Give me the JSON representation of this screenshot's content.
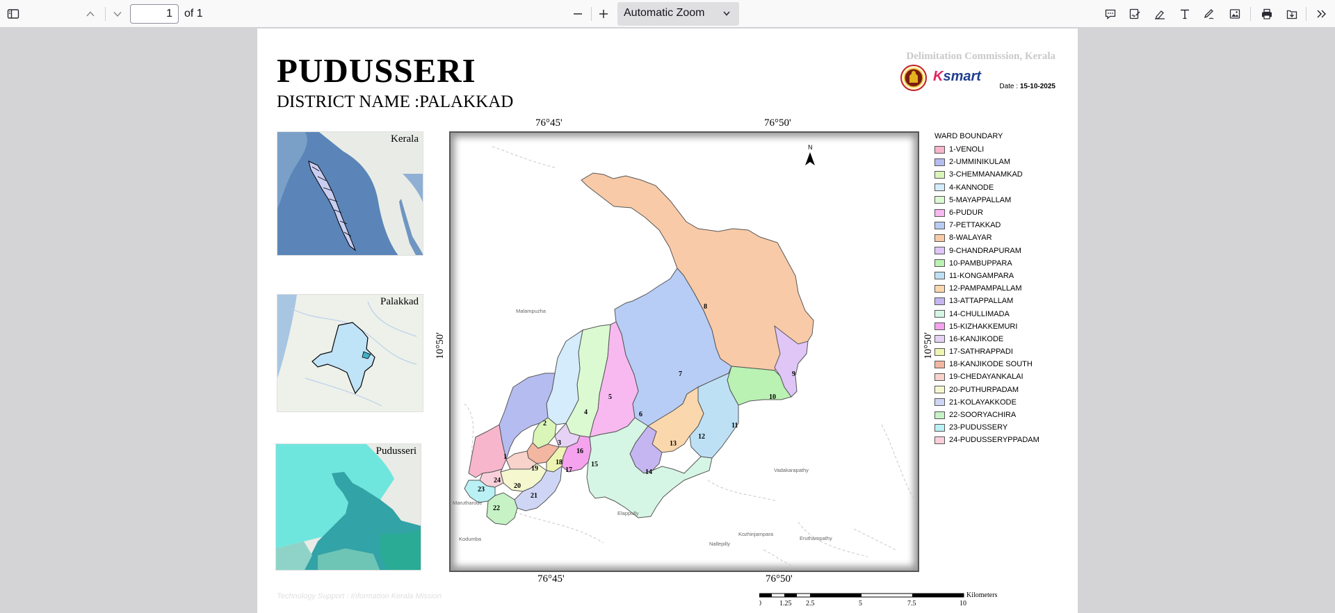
{
  "toolbar": {
    "page_current": "1",
    "page_total": "of 1",
    "zoom": "Automatic Zoom",
    "icons": [
      "sidebar-icon",
      "up-icon",
      "down-icon",
      "zoom-out-icon",
      "zoom-in-icon",
      "comment-icon",
      "signature-icon",
      "highlight-icon",
      "text-icon",
      "draw-icon",
      "image-icon",
      "print-icon",
      "save-icon",
      "tools-icon"
    ]
  },
  "document": {
    "title": "PUDUSSERI",
    "district": "DISTRICT NAME :PALAKKAD",
    "commission": "Delimitation Commission, Kerala",
    "date_label": "Date :",
    "date_value": "15-10-2025",
    "ksmart_k": "K",
    "ksmart_rest": "smart",
    "insets": {
      "kerala": "Kerala",
      "palakkad": "Palakkad",
      "pudusseri": "Pudusseri"
    },
    "coords": {
      "top_left": "76°45'",
      "top_right": "76°50'",
      "bottom_left": "76°45'",
      "bottom_right": "76°50'",
      "left": "10°50'",
      "right": "10°50'"
    },
    "north": "N",
    "map_places": {
      "malampuzha": "Malampuzha",
      "vadakarapathy": "Vadakarapathy",
      "marutharode": "Marutharode",
      "elappully": "Elappully",
      "kodumba": "Kodumba",
      "kozhinjampara": "Kozhinjampara",
      "nallepilly": "Nallepilly",
      "eruthampathy": "Eruthampathy"
    },
    "legend_title": "WARD BOUNDARY",
    "wards": [
      {
        "label": "1-VENOLI",
        "color": "#f7b6cc"
      },
      {
        "label": "2-UMMINIKULAM",
        "color": "#b5bcf0"
      },
      {
        "label": "3-CHEMMANAMKAD",
        "color": "#d9f5b8"
      },
      {
        "label": "4-KANNODE",
        "color": "#d4ecfb"
      },
      {
        "label": "5-MAYAPPALLAM",
        "color": "#dcfad2"
      },
      {
        "label": "6-PUDUR",
        "color": "#f7b9f0"
      },
      {
        "label": "7-PETTAKKAD",
        "color": "#b7cdf5"
      },
      {
        "label": "8-WALAYAR",
        "color": "#f9caa8"
      },
      {
        "label": "9-CHANDRAPURAM",
        "color": "#dfc6f7"
      },
      {
        "label": "10-PAMBUPPARA",
        "color": "#b9f2b3"
      },
      {
        "label": "11-KONGAMPARA",
        "color": "#bde0f5"
      },
      {
        "label": "12-PAMPAMPALLAM",
        "color": "#fbd7ae"
      },
      {
        "label": "13-ATTAPPALLAM",
        "color": "#c5b6f2"
      },
      {
        "label": "14-CHULLIMADA",
        "color": "#d6f6e5"
      },
      {
        "label": "15-KIZHAKKEMURI",
        "color": "#f5a3ee"
      },
      {
        "label": "16-KANJIKODE",
        "color": "#e5d2f5"
      },
      {
        "label": "17-SATHRAPPADI",
        "color": "#eef5b2"
      },
      {
        "label": "18-KANJIKODE SOUTH",
        "color": "#f3b6a0"
      },
      {
        "label": "19-CHEDAYANKALAI",
        "color": "#f8d3cb"
      },
      {
        "label": "20-PUTHURPADAM",
        "color": "#f5f7cf"
      },
      {
        "label": "21-KOLAYAKKODE",
        "color": "#cfd6f5"
      },
      {
        "label": "22-SOORYACHIRA",
        "color": "#c6f2c5"
      },
      {
        "label": "23-PUDUSSERY",
        "color": "#b9f1f5"
      },
      {
        "label": "24-PUDUSSERYPPADAM",
        "color": "#f9d0da"
      }
    ],
    "ward_numbers": [
      "1",
      "2",
      "3",
      "4",
      "5",
      "6",
      "7",
      "8",
      "9",
      "10",
      "11",
      "12",
      "13",
      "14",
      "15",
      "16",
      "17",
      "18",
      "19",
      "20",
      "21",
      "22",
      "23",
      "24"
    ],
    "scale": {
      "unit": "Kilometers",
      "ticks": [
        "0",
        "1.25",
        "2.5",
        "5",
        "7.5",
        "10"
      ]
    },
    "credit": "Technology Support : Information Kerala Mission"
  }
}
